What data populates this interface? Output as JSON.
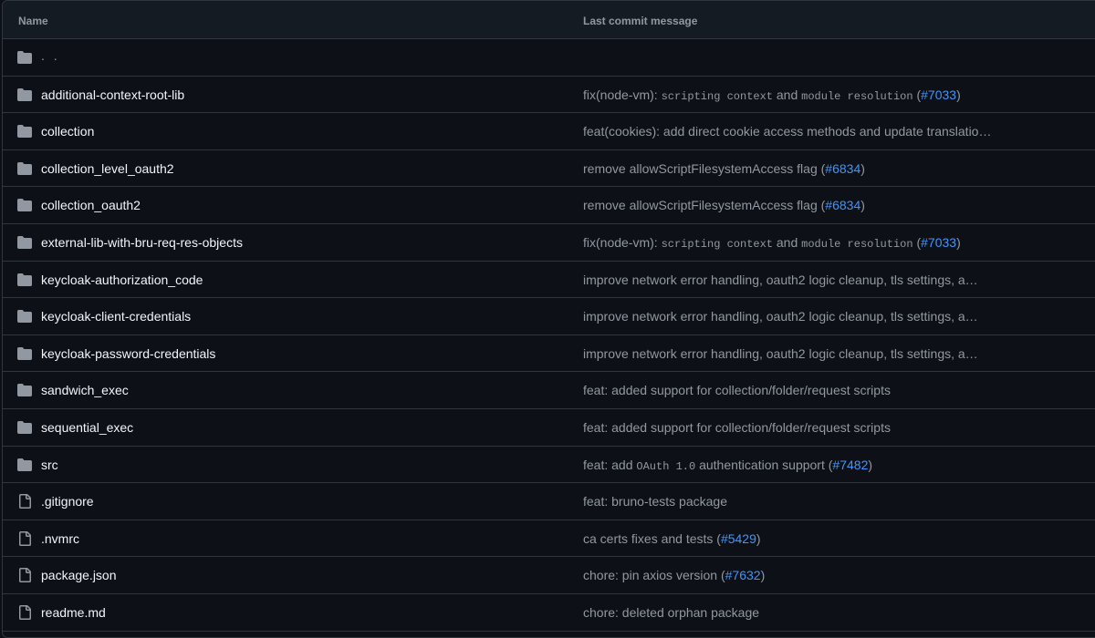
{
  "header": {
    "name": "Name",
    "message": "Last commit message"
  },
  "parent": {
    "name": ". ."
  },
  "rows": [
    {
      "type": "folder",
      "name": "additional-context-root-lib",
      "msg": [
        {
          "t": "fix(node-vm): "
        },
        {
          "t": "scripting context",
          "code": true
        },
        {
          "t": " and "
        },
        {
          "t": "module resolution",
          "code": true
        },
        {
          "t": " ("
        },
        {
          "t": "#7033",
          "link": true
        },
        {
          "t": ")"
        }
      ]
    },
    {
      "type": "folder",
      "name": "collection",
      "msg": [
        {
          "t": "feat(cookies): add direct cookie access methods and update translatio…"
        }
      ]
    },
    {
      "type": "folder",
      "name": "collection_level_oauth2",
      "msg": [
        {
          "t": "remove allowScriptFilesystemAccess flag ("
        },
        {
          "t": "#6834",
          "link": true
        },
        {
          "t": ")"
        }
      ]
    },
    {
      "type": "folder",
      "name": "collection_oauth2",
      "msg": [
        {
          "t": "remove allowScriptFilesystemAccess flag ("
        },
        {
          "t": "#6834",
          "link": true
        },
        {
          "t": ")"
        }
      ]
    },
    {
      "type": "folder",
      "name": "external-lib-with-bru-req-res-objects",
      "msg": [
        {
          "t": "fix(node-vm): "
        },
        {
          "t": "scripting context",
          "code": true
        },
        {
          "t": " and "
        },
        {
          "t": "module resolution",
          "code": true
        },
        {
          "t": " ("
        },
        {
          "t": "#7033",
          "link": true
        },
        {
          "t": ")"
        }
      ]
    },
    {
      "type": "folder",
      "name": "keycloak-authorization_code",
      "msg": [
        {
          "t": "improve network error handling, oauth2 logic cleanup, tls settings, a…"
        }
      ]
    },
    {
      "type": "folder",
      "name": "keycloak-client-credentials",
      "msg": [
        {
          "t": "improve network error handling, oauth2 logic cleanup, tls settings, a…"
        }
      ]
    },
    {
      "type": "folder",
      "name": "keycloak-password-credentials",
      "msg": [
        {
          "t": "improve network error handling, oauth2 logic cleanup, tls settings, a…"
        }
      ]
    },
    {
      "type": "folder",
      "name": "sandwich_exec",
      "msg": [
        {
          "t": "feat: added support for collection/folder/request scripts"
        }
      ]
    },
    {
      "type": "folder",
      "name": "sequential_exec",
      "msg": [
        {
          "t": "feat: added support for collection/folder/request scripts"
        }
      ]
    },
    {
      "type": "folder",
      "name": "src",
      "msg": [
        {
          "t": "feat: add "
        },
        {
          "t": "OAuth 1.0",
          "code": true
        },
        {
          "t": " authentication support ("
        },
        {
          "t": "#7482",
          "link": true
        },
        {
          "t": ")"
        }
      ]
    },
    {
      "type": "file",
      "name": ".gitignore",
      "msg": [
        {
          "t": "feat: bruno-tests package"
        }
      ]
    },
    {
      "type": "file",
      "name": ".nvmrc",
      "msg": [
        {
          "t": "ca certs fixes and tests ("
        },
        {
          "t": "#5429",
          "link": true
        },
        {
          "t": ")"
        }
      ]
    },
    {
      "type": "file",
      "name": "package.json",
      "msg": [
        {
          "t": "chore: pin axios version ("
        },
        {
          "t": "#7632",
          "link": true
        },
        {
          "t": ")"
        }
      ]
    },
    {
      "type": "file",
      "name": "readme.md",
      "msg": [
        {
          "t": "chore: deleted orphan package"
        }
      ]
    }
  ],
  "colors": {
    "folder": "#9198a1",
    "file": "#9198a1",
    "link": "#4493f8",
    "text": "#f0f6fc",
    "muted": "#9198a1"
  }
}
